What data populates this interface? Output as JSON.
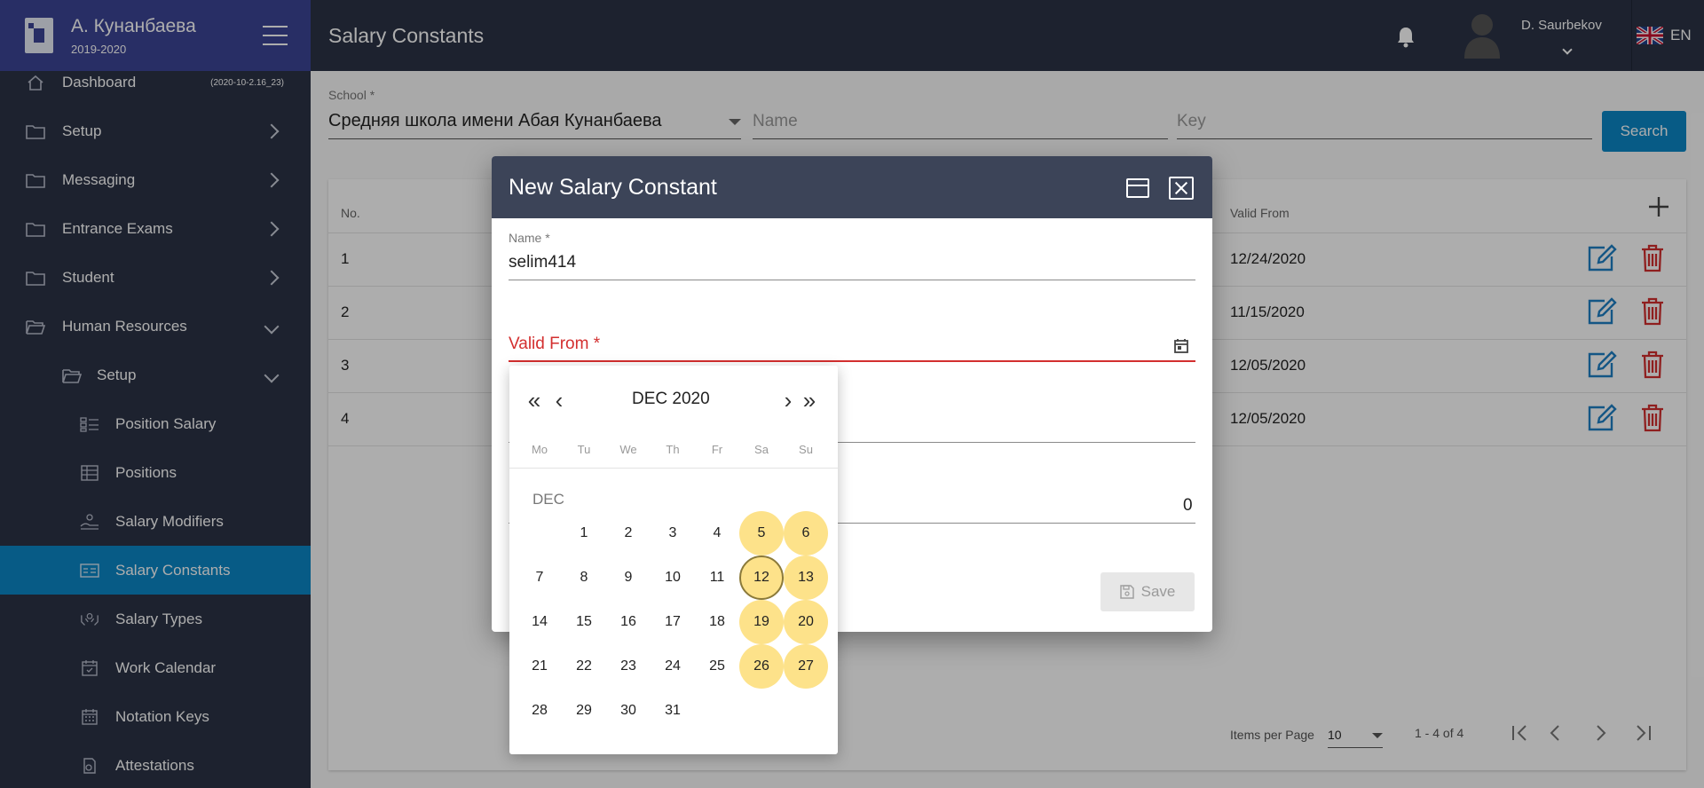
{
  "app": {
    "title": "А. Кунанбаева",
    "year": "2019-2020",
    "version": "(2020-10-2.16_23)"
  },
  "sidebar": {
    "items": [
      {
        "label": "Dashboard",
        "icon": "home-icon"
      },
      {
        "label": "Setup",
        "icon": "folder-icon"
      },
      {
        "label": "Messaging",
        "icon": "folder-icon"
      },
      {
        "label": "Entrance Exams",
        "icon": "folder-icon"
      },
      {
        "label": "Student",
        "icon": "folder-icon"
      },
      {
        "label": "Human Resources",
        "icon": "folder-open-icon"
      },
      {
        "label": "Setup",
        "icon": "folder-open-icon"
      },
      {
        "label": "Position Salary",
        "icon": "position-salary-icon"
      },
      {
        "label": "Positions",
        "icon": "table-icon"
      },
      {
        "label": "Salary Modifiers",
        "icon": "salary-modifiers-icon"
      },
      {
        "label": "Salary Constants",
        "icon": "salary-constants-icon"
      },
      {
        "label": "Salary Types",
        "icon": "salary-types-icon"
      },
      {
        "label": "Work Calendar",
        "icon": "calendar-icon"
      },
      {
        "label": "Notation Keys",
        "icon": "calendar-grid-icon"
      },
      {
        "label": "Attestations",
        "icon": "attestations-icon"
      }
    ]
  },
  "header": {
    "title": "Salary Constants",
    "username": "D. Saurbekov",
    "language": "EN"
  },
  "filters": {
    "school_label": "School *",
    "school_value": "Средняя школа имени Абая Кунанбаева",
    "name_placeholder": "Name",
    "key_placeholder": "Key",
    "search_label": "Search"
  },
  "table": {
    "headers": {
      "no": "No.",
      "valid_from": "Valid From"
    },
    "rows": [
      {
        "no": "1",
        "valid_from": "12/24/2020"
      },
      {
        "no": "2",
        "valid_from": "11/15/2020"
      },
      {
        "no": "3",
        "valid_from": "12/05/2020"
      },
      {
        "no": "4",
        "valid_from": "12/05/2020"
      }
    ],
    "footer": {
      "items_per_page_label": "Items per Page",
      "items_per_page": "10",
      "range": "1 - 4 of 4"
    }
  },
  "dialog": {
    "title": "New Salary Constant",
    "name_label": "Name *",
    "name_value": "selim414",
    "valid_from_label": "Valid From *",
    "number_value": "0",
    "save_label": "Save"
  },
  "calendar": {
    "month_year": "DEC 2020",
    "month_label": "DEC",
    "weekdays": [
      "Mo",
      "Tu",
      "We",
      "Th",
      "Fr",
      "Sa",
      "Su"
    ],
    "weeks": [
      [
        "",
        "1",
        "2",
        "3",
        "4",
        "5",
        "6"
      ],
      [
        "7",
        "8",
        "9",
        "10",
        "11",
        "12",
        "13"
      ],
      [
        "14",
        "15",
        "16",
        "17",
        "18",
        "19",
        "20"
      ],
      [
        "21",
        "22",
        "23",
        "24",
        "25",
        "26",
        "27"
      ],
      [
        "28",
        "29",
        "30",
        "31",
        "",
        "",
        ""
      ]
    ],
    "today": "12",
    "nav": {
      "prev_year": "«",
      "prev_month": "‹",
      "next_month": "›",
      "next_year": "»"
    }
  },
  "colors": {
    "sidebar_bg": "#2b3346",
    "brand": "#3c4496",
    "accent": "#0b86c6",
    "error": "#d32f2f",
    "weekend": "#fde28a",
    "delete": "#d32f2f"
  }
}
